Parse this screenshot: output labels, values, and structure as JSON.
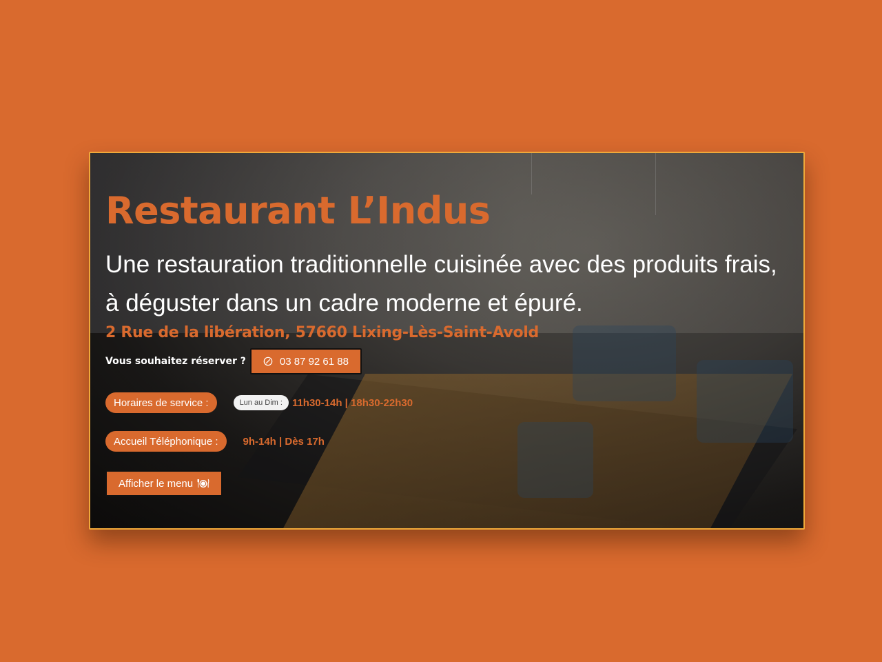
{
  "hero": {
    "title": "Restaurant L’Indus",
    "subtitle": "Une restauration traditionnelle cuisinée avec des produits frais, à déguster dans un cadre moderne et épuré.",
    "address": "2 Rue de la libération, 57660 Lixing-Lès-Saint-Avold",
    "reserve_label": "Vous souhaitez réserver ?",
    "phone_number": "03 87 92 61 88",
    "phone_icon": "phone-icon",
    "service_hours": {
      "label": "Horaires de service :",
      "days": "Lun au Dim :",
      "hours": "11h30-14h | 18h30-22h30"
    },
    "phone_reception": {
      "label": "Accueil Téléphonique :",
      "hours": "9h-14h | Dès 17h"
    },
    "menu_button": "Afficher le menu",
    "menu_icon": "plate-cutlery-icon"
  },
  "colors": {
    "page_background": "#d96a2e",
    "accent": "#d96a2e",
    "card_border": "#f0a93a",
    "text_light": "#ffffff"
  }
}
